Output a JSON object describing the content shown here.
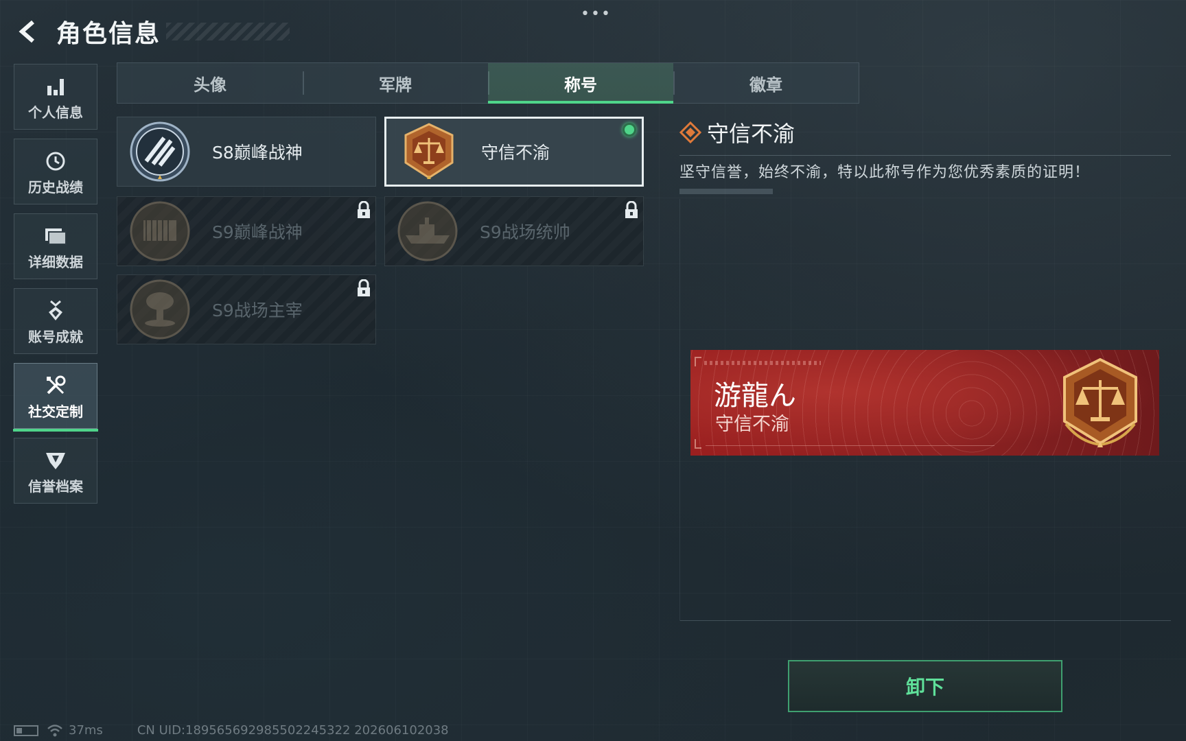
{
  "header": {
    "title": "角色信息",
    "back_icon": "back-arrow-icon",
    "menu_dots": "•••"
  },
  "sidebar": {
    "items": [
      {
        "label": "个人信息",
        "icon": "bar-chart-icon",
        "active": false
      },
      {
        "label": "历史战绩",
        "icon": "history-clock-icon",
        "active": false
      },
      {
        "label": "详细数据",
        "icon": "folder-icon",
        "active": false
      },
      {
        "label": "账号成就",
        "icon": "medal-icon",
        "active": false
      },
      {
        "label": "社交定制",
        "icon": "tools-icon",
        "active": true
      },
      {
        "label": "信誉档案",
        "icon": "shield-wing-icon",
        "active": false
      }
    ]
  },
  "tabs": [
    {
      "label": "头像",
      "active": false
    },
    {
      "label": "军牌",
      "active": false
    },
    {
      "label": "称号",
      "active": true
    },
    {
      "label": "徽章",
      "active": false
    }
  ],
  "cards": [
    {
      "name": "S8巅峰战神",
      "badge": "s8-peak-badge",
      "locked": false,
      "selected": false
    },
    {
      "name": "守信不渝",
      "badge": "scales-badge",
      "locked": false,
      "selected": true,
      "equipped": true
    },
    {
      "name": "S9巅峰战神",
      "badge": "fortress-badge",
      "locked": true,
      "selected": false
    },
    {
      "name": "S9战场统帅",
      "badge": "battleship-badge",
      "locked": true,
      "selected": false
    },
    {
      "name": "S9战场主宰",
      "badge": "mushroom-cloud-badge",
      "locked": true,
      "selected": false
    }
  ],
  "detail": {
    "title": "守信不渝",
    "description": "坚守信誉，始终不渝，特以此称号作为您优秀素质的证明！",
    "title_icon": "diamond-emblem-icon"
  },
  "banner": {
    "player_name": "游龍ん",
    "title": "守信不渝",
    "emblem": "scales-emblem"
  },
  "buttons": {
    "unequip": "卸下"
  },
  "status": {
    "ping": "37ms",
    "uid": "CN UID:189565692985502245322 202606102038"
  },
  "colors": {
    "accent_green": "#4fd58a",
    "banner_red": "#9a1f1f",
    "bronze": "#b0642c"
  }
}
